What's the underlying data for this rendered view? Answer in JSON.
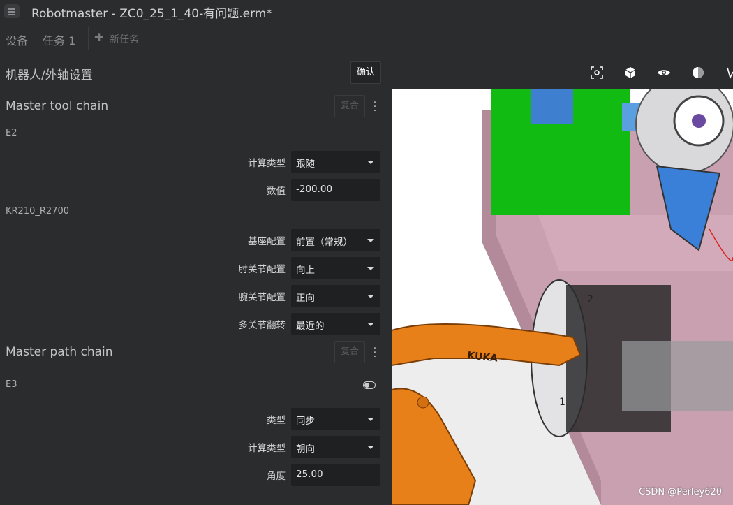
{
  "window": {
    "title": "Robotmaster - ZC0_25_1_40-有问题.erm*"
  },
  "tabs": [
    {
      "label": "设备"
    },
    {
      "label": "任务 1"
    }
  ],
  "new_task": {
    "label": "新任务"
  },
  "panel": {
    "title": "机器人/外轴设置",
    "confirm_label": "确认"
  },
  "master_tool_chain": {
    "title": "Master tool chain",
    "combine_label": "复合",
    "axis": "E2",
    "fields": [
      {
        "label": "计算类型",
        "value": "跟随",
        "type": "dropdown"
      },
      {
        "label": "数值",
        "value": "-200.00",
        "type": "input"
      }
    ],
    "robot": "KR210_R2700",
    "robot_fields": [
      {
        "label": "基座配置",
        "value": "前置（常规）",
        "type": "dropdown"
      },
      {
        "label": "肘关节配置",
        "value": "向上",
        "type": "dropdown"
      },
      {
        "label": "腕关节配置",
        "value": "正向",
        "type": "dropdown"
      },
      {
        "label": "多关节翻转",
        "value": "最近的",
        "type": "dropdown"
      }
    ]
  },
  "master_path_chain": {
    "title": "Master path chain",
    "combine_label": "复合",
    "axis": "E3",
    "fields": [
      {
        "label": "类型",
        "value": "同步",
        "type": "dropdown"
      },
      {
        "label": "计算类型",
        "value": "朝向",
        "type": "dropdown"
      },
      {
        "label": "角度",
        "value": "25.00",
        "type": "input"
      }
    ]
  },
  "viewport": {
    "toolbar": [
      "fit-view-icon",
      "cube-view-icon",
      "visibility-eye-icon",
      "render-sphere-icon"
    ],
    "robot_brand": "KUKA",
    "tool_numbers": [
      "2",
      "1"
    ],
    "colors": {
      "robot": "#e8801a",
      "base": "#c99aab",
      "fixture": "#12bb12",
      "panel": "#2b2c2e"
    }
  },
  "watermark": "CSDN @Perley620"
}
